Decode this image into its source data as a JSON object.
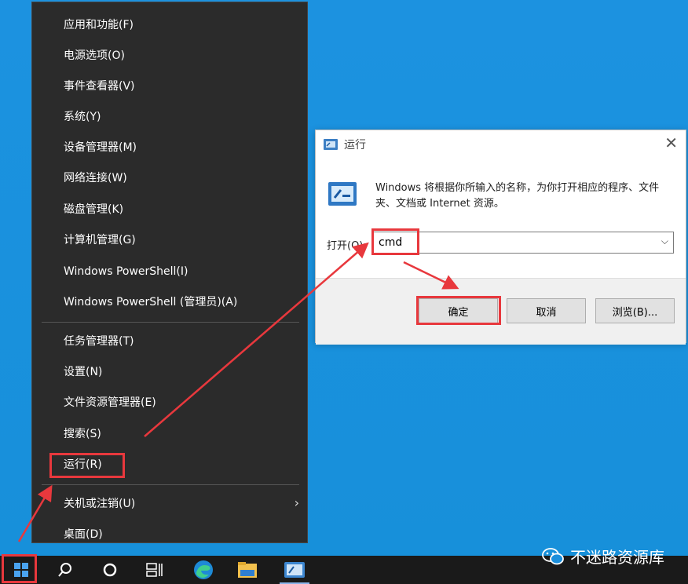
{
  "winx_menu": {
    "items": [
      {
        "label": "应用和功能(F)"
      },
      {
        "label": "电源选项(O)"
      },
      {
        "label": "事件查看器(V)"
      },
      {
        "label": "系统(Y)"
      },
      {
        "label": "设备管理器(M)"
      },
      {
        "label": "网络连接(W)"
      },
      {
        "label": "磁盘管理(K)"
      },
      {
        "label": "计算机管理(G)"
      },
      {
        "label": "Windows PowerShell(I)"
      },
      {
        "label": "Windows PowerShell (管理员)(A)"
      },
      {
        "label": "任务管理器(T)"
      },
      {
        "label": "设置(N)"
      },
      {
        "label": "文件资源管理器(E)"
      },
      {
        "label": "搜索(S)"
      },
      {
        "label": "运行(R)"
      },
      {
        "label": "关机或注销(U)"
      },
      {
        "label": "桌面(D)"
      }
    ]
  },
  "run_dialog": {
    "title": "运行",
    "description": "Windows 将根据你所输入的名称，为你打开相应的程序、文件夹、文档或 Internet 资源。",
    "open_label": "打开(O):",
    "input_value": "cmd",
    "ok_label": "确定",
    "cancel_label": "取消",
    "browse_label": "浏览(B)..."
  },
  "taskbar": {
    "icons": [
      "windows-start-icon",
      "search-icon",
      "cortana-icon",
      "task-view-icon",
      "edge-icon",
      "file-explorer-icon",
      "run-app-icon"
    ]
  },
  "watermark": {
    "text": "不迷路资源库"
  },
  "colors": {
    "highlight": "#e8383d",
    "menu_bg": "#2b2b2b",
    "desktop": "#1b8fdc"
  }
}
